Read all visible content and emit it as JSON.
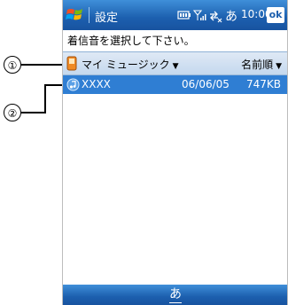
{
  "titlebar": {
    "title": "設定",
    "ime": "あ",
    "time": "10:00",
    "ok_label": "ok"
  },
  "instruction": "着信音を選択して下さい。",
  "header": {
    "folder_label": "マイ ミュージック",
    "sort_label": "名前順"
  },
  "file": {
    "name": "XXXX",
    "date": "06/06/05",
    "size": "747KB"
  },
  "bottombar": {
    "ime": "あ"
  },
  "callouts": [
    "①",
    "②"
  ],
  "colors": {
    "titlebar": "#1c5fae",
    "selection": "#2f7ed3",
    "header": "#c4d8ee"
  },
  "icons": {
    "start": "windows-flag-icon",
    "battery": "battery-icon",
    "signal": "signal-icon",
    "connectivity": "connectivity-icon",
    "folder": "phone-folder-icon",
    "file": "music-file-icon"
  }
}
